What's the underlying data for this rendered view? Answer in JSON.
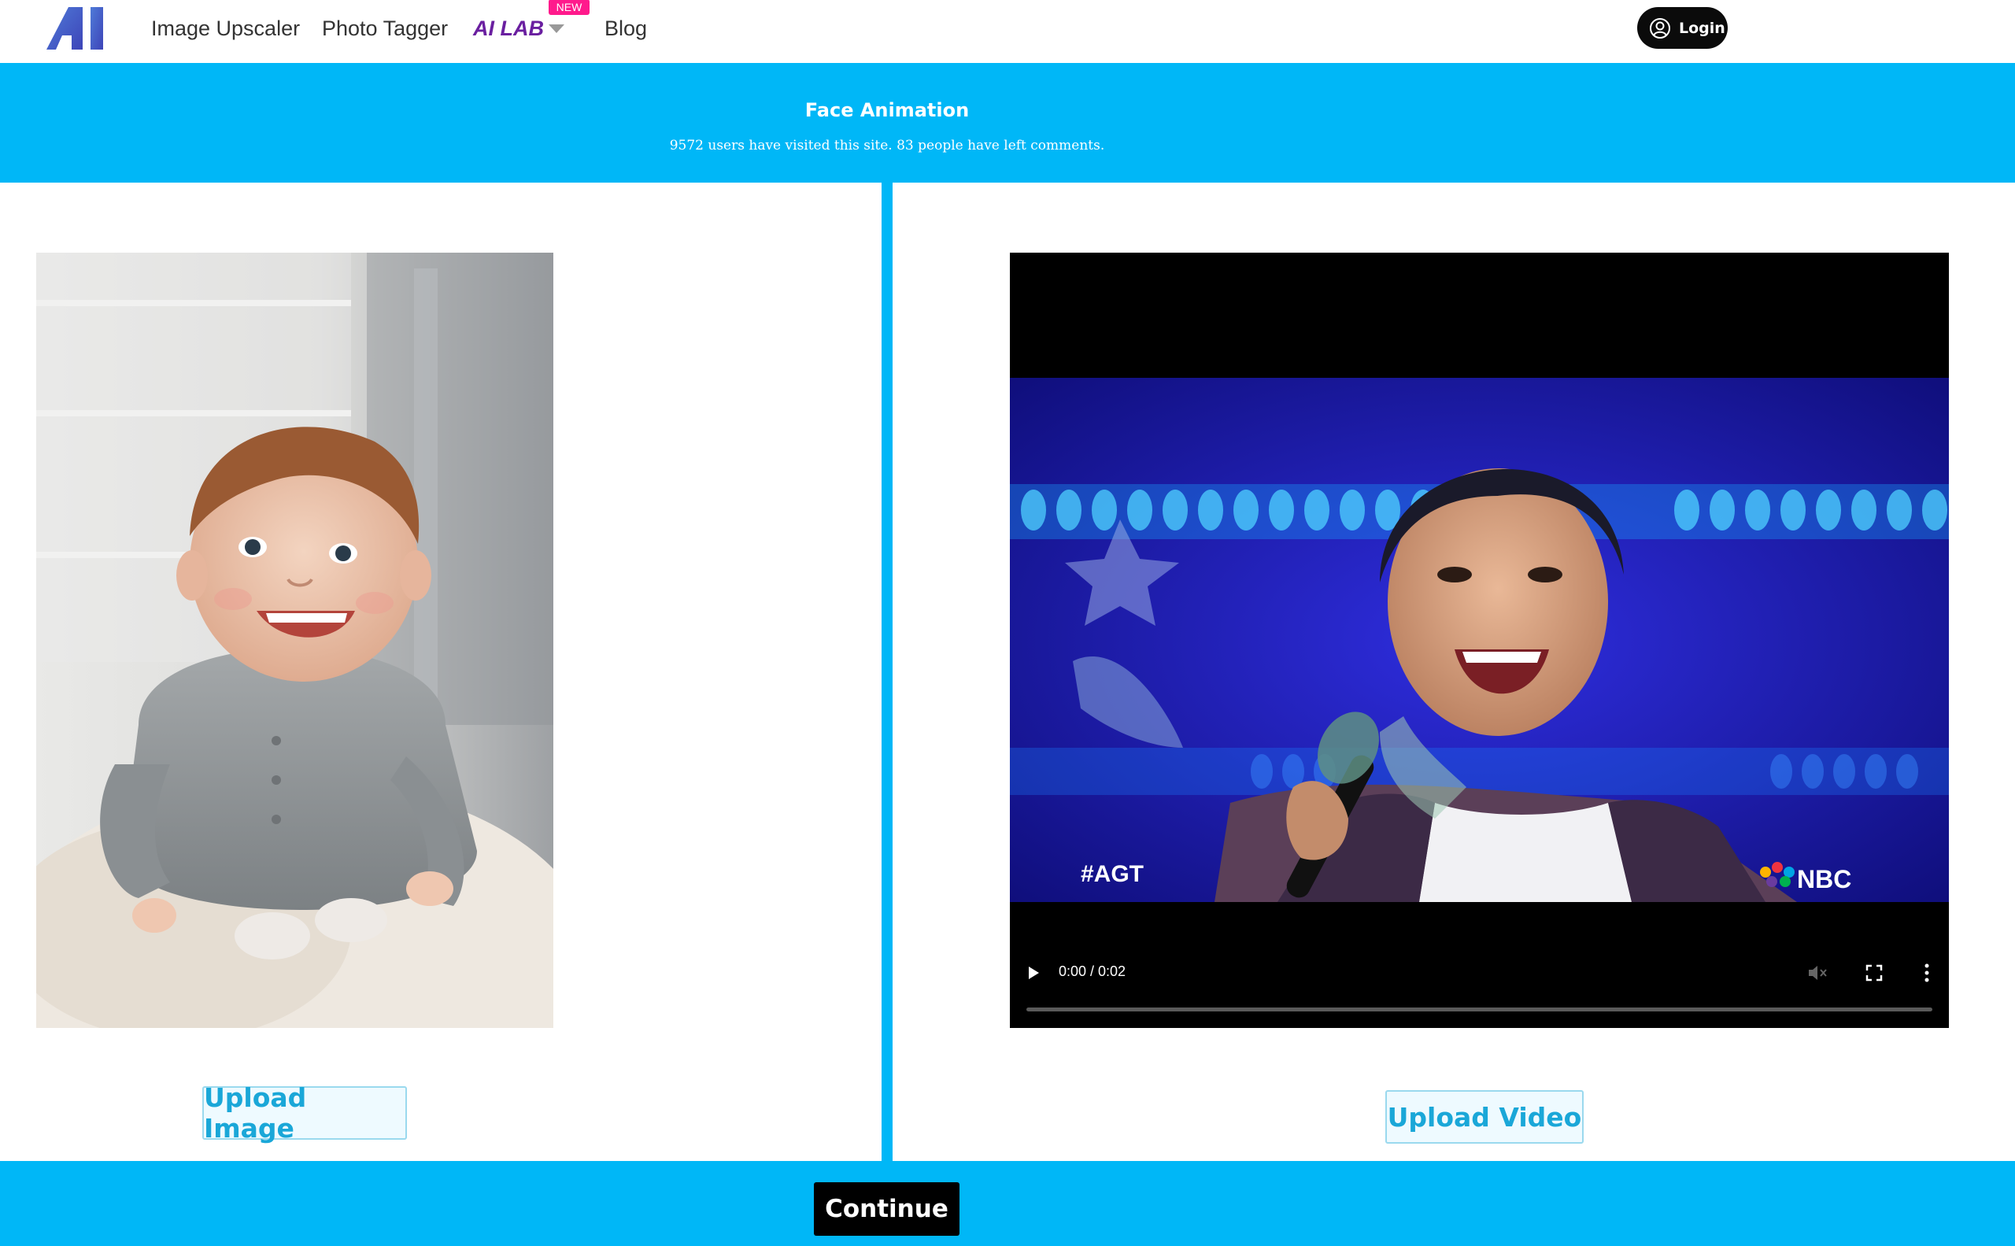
{
  "nav": {
    "logo_text": "AI",
    "links": [
      {
        "label": "Image Upscaler"
      },
      {
        "label": "Photo Tagger"
      },
      {
        "label": "AI LAB"
      },
      {
        "label": "Blog"
      }
    ],
    "new_badge": "NEW",
    "login_label": "Login"
  },
  "header": {
    "title": "Face Animation",
    "subtitle": "9572 users have visited this site. 83 people have left comments."
  },
  "left_panel": {
    "upload_label": "Upload Image"
  },
  "right_panel": {
    "upload_label": "Upload Video",
    "video": {
      "time": "0:00 / 0:02",
      "overlay_left": "#AGT",
      "overlay_right": "NBC"
    }
  },
  "footer": {
    "continue_label": "Continue"
  },
  "colors": {
    "accent": "#00b7f7",
    "ai_lab": "#6a1fa0",
    "badge": "#ff1a8c",
    "upload_text": "#1aa7d8"
  }
}
